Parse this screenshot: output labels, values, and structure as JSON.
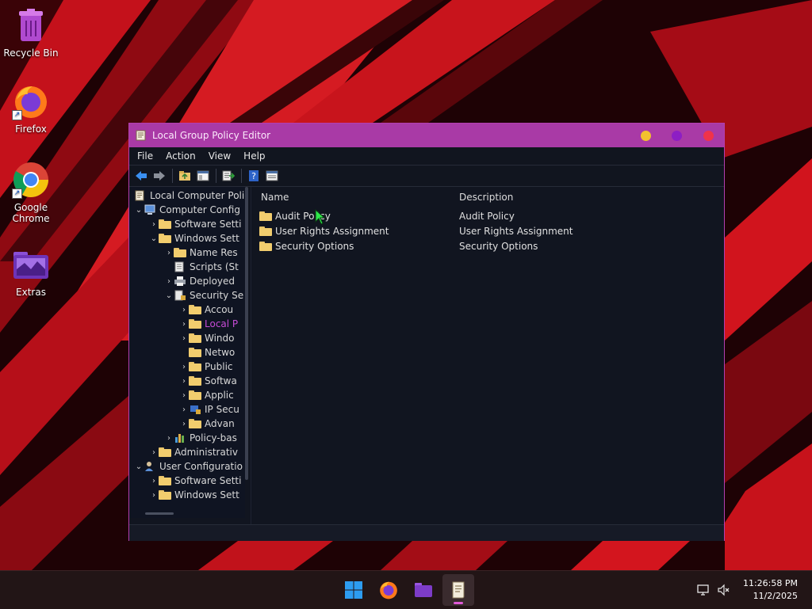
{
  "desktop": {
    "icons": [
      {
        "label": "Recycle Bin",
        "icon": "recycle-bin-icon"
      },
      {
        "label": "Firefox",
        "icon": "firefox-icon"
      },
      {
        "label": "Google Chrome",
        "icon": "chrome-icon"
      },
      {
        "label": "Extras",
        "icon": "folder-icon"
      }
    ]
  },
  "window": {
    "title": "Local Group Policy Editor",
    "accent": "#a93aa6",
    "menu": [
      "File",
      "Action",
      "View",
      "Help"
    ],
    "toolbar": [
      "back-arrow-icon",
      "forward-arrow-icon",
      "up-folder-icon",
      "show-hide-tree-icon",
      "export-list-icon",
      "help-icon",
      "properties-icon"
    ]
  },
  "tree": [
    {
      "label": "Local Computer Polic",
      "level": 0,
      "expander": "",
      "icon": "policy-document-icon"
    },
    {
      "label": "Computer Config",
      "level": 0,
      "expander": "expanded",
      "icon": "computer-icon"
    },
    {
      "label": "Software Setti",
      "level": 1,
      "expander": "collapsed",
      "icon": "folder-icon"
    },
    {
      "label": "Windows Sett",
      "level": 1,
      "expander": "expanded",
      "icon": "folder-icon"
    },
    {
      "label": "Name Res",
      "level": 2,
      "expander": "collapsed",
      "icon": "folder-icon"
    },
    {
      "label": "Scripts (St",
      "level": 2,
      "expander": "",
      "icon": "script-icon"
    },
    {
      "label": "Deployed",
      "level": 2,
      "expander": "collapsed",
      "icon": "printer-icon"
    },
    {
      "label": "Security Se",
      "level": 2,
      "expander": "expanded",
      "icon": "security-settings-icon"
    },
    {
      "label": "Accou",
      "level": 3,
      "expander": "collapsed",
      "icon": "folder-icon"
    },
    {
      "label": "Local P",
      "level": 3,
      "expander": "collapsed",
      "icon": "folder-icon",
      "selected": true
    },
    {
      "label": "Windo",
      "level": 3,
      "expander": "collapsed",
      "icon": "folder-icon"
    },
    {
      "label": "Netwo",
      "level": 3,
      "expander": "",
      "icon": "folder-icon"
    },
    {
      "label": "Public",
      "level": 3,
      "expander": "collapsed",
      "icon": "folder-icon"
    },
    {
      "label": "Softwa",
      "level": 3,
      "expander": "collapsed",
      "icon": "folder-icon"
    },
    {
      "label": "Applic",
      "level": 3,
      "expander": "collapsed",
      "icon": "folder-icon"
    },
    {
      "label": "IP Secu",
      "level": 3,
      "expander": "collapsed",
      "icon": "ip-security-icon"
    },
    {
      "label": "Advan",
      "level": 3,
      "expander": "collapsed",
      "icon": "folder-icon"
    },
    {
      "label": "Policy-bas",
      "level": 2,
      "expander": "collapsed",
      "icon": "chart-icon"
    },
    {
      "label": "Administrativ",
      "level": 1,
      "expander": "collapsed",
      "icon": "folder-icon"
    },
    {
      "label": "User Configuratio",
      "level": 0,
      "expander": "expanded",
      "icon": "user-icon"
    },
    {
      "label": "Software Setti",
      "level": 1,
      "expander": "collapsed",
      "icon": "folder-icon"
    },
    {
      "label": "Windows Sett",
      "level": 1,
      "expander": "collapsed",
      "icon": "folder-icon"
    }
  ],
  "list": {
    "columns": [
      "Name",
      "Description"
    ],
    "rows": [
      {
        "name": "Audit Policy",
        "description": "Audit Policy"
      },
      {
        "name": "User Rights Assignment",
        "description": "User Rights Assignment"
      },
      {
        "name": "Security Options",
        "description": "Security Options"
      }
    ]
  },
  "taskbar": {
    "apps": [
      "start-icon",
      "firefox-icon",
      "file-explorer-icon",
      "group-policy-icon"
    ],
    "active_app": "group-policy-icon",
    "time": "11:26:58 PM",
    "date": "11/2/2025"
  }
}
